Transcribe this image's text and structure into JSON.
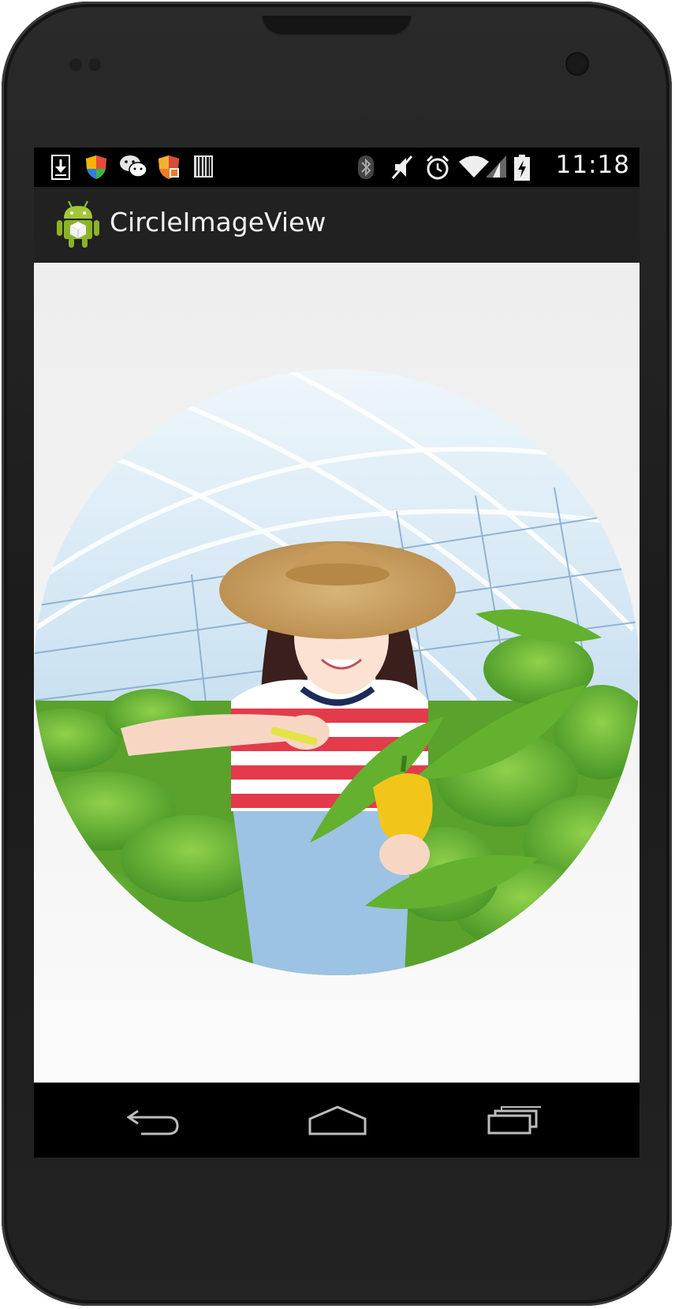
{
  "status_bar": {
    "time": "11:18",
    "left_icons": [
      "download-icon",
      "shield-icon",
      "wechat-icon",
      "security-icon",
      "barcode-icon"
    ],
    "right_icons": [
      "bluetooth-icon",
      "vibrate-icon",
      "alarm-icon",
      "wifi-icon",
      "signal-icon",
      "battery-charging-icon"
    ]
  },
  "action_bar": {
    "title": "CircleImageView",
    "icon": "android-icon"
  },
  "content": {
    "image": "circle-image"
  },
  "nav_bar": {
    "buttons": [
      "back-icon",
      "home-icon",
      "recents-icon"
    ]
  },
  "colors": {
    "action_bar_bg": "#212121",
    "content_bg": "#eeeeee",
    "status_bar_bg": "#000000"
  }
}
